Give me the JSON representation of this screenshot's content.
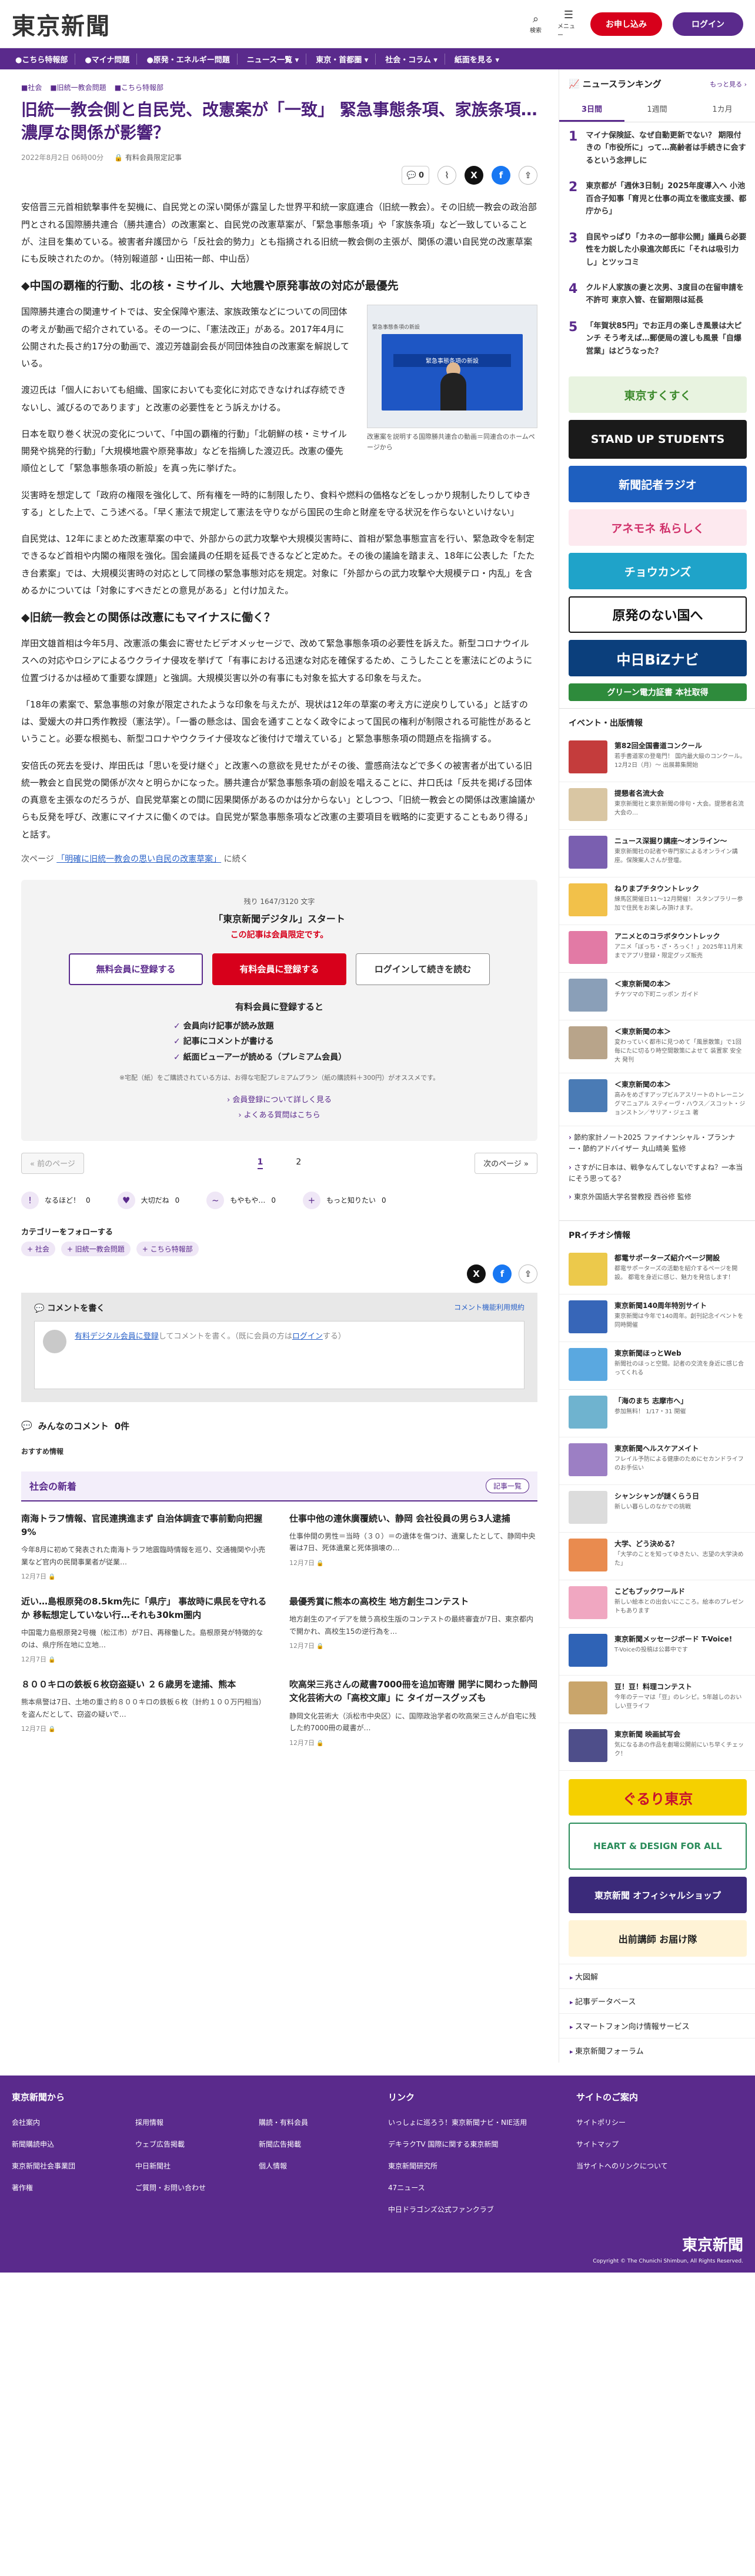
{
  "header": {
    "logo": "東京新聞",
    "search": "検索",
    "menu": "メニュー",
    "subscribe": "お申し込み",
    "login": "ログイン"
  },
  "nav": [
    "●こちら特報部",
    "●マイナ問題",
    "●原発・エネルギー問題",
    "ニュース一覧 ▾",
    "東京・首都圏 ▾",
    "社会・コラム ▾",
    "紙面を見る ▾"
  ],
  "article": {
    "crumbs": [
      "■社会",
      "■旧統一教会問題",
      "■こちら特報部"
    ],
    "title": "旧統一教会側と自民党、改憲案が「一致」 緊急事態条項、家族条項…濃厚な関係が影響？",
    "date": "2022年8月2日 06時00分",
    "paid": "有料会員限定記事",
    "comment_count": "0",
    "p1": "安倍晋三元首相銃撃事件を契機に、自民党との深い関係が露呈した世界平和統一家庭連合（旧統一教会）。その旧統一教会の政治部門とされる国際勝共連合（勝共連合）の改憲案と、自民党の改憲草案が、「緊急事態条項」や「家族条項」など一致していることが、注目を集めている。被害者弁護団から「反社会的勢力」とも指摘される旧統一教会側の主張が、関係の濃い自民党の改憲草案にも反映されたのか。（特別報道部・山田祐一郎、中山岳）",
    "h1": "◆中国の覇権的行動、北の核・ミサイル、大地震や原発事故の対応が最優先",
    "p2": "国際勝共連合の関連サイトでは、安全保障や憲法、家族政策などについての同団体の考えが動画で紹介されている。その一つに、「憲法改正」がある。2017年4月に公開された長さ約17分の動画で、渡辺芳雄副会長が同団体独自の改憲案を解説している。",
    "p3": "渡辺氏は「個人においても組織、国家においても変化に対応できなければ存続できないし、滅びるのであります」と改憲の必要性をとう訴えかける。",
    "p4": "日本を取り巻く状況の変化について、「中国の覇権的行動」「北朝鮮の核・ミサイル開発や挑発的行動」「大規模地震や原発事故」などを指摘した渡辺氏。改憲の優先順位として「緊急事態条項の新設」を真っ先に挙げた。",
    "fig_tag": "緊急事態条項の新設",
    "fig_screen": "緊急事態条項の新設",
    "fig_caption": "改憲案を説明する国際勝共連合の動画＝同連合のホームページから",
    "p5": "災害時を想定して「政府の権限を強化して、所有権を一時的に制限したり、食料や燃料の価格などをしっかり規制したりしてゆきする」とした上で、こう述べる。「早く憲法で規定して憲法を守りながら国民の生命と財産を守る状況を作らないといけない」",
    "p6": "自民党は、12年にまとめた改憲草案の中で、外部からの武力攻撃や大規模災害時に、首相が緊急事態宣言を行い、緊急政令を制定できるなど首相や内閣の権限を強化。国会議員の任期を延長できるなどと定めた。その後の議論を踏まえ、18年に公表した「たたき台素案」では、大規模災害時の対応として同様の緊急事態対応を規定。対象に「外部からの武力攻撃や大規模テロ・内乱」を含めるかについては「対象にすべきだとの意見がある」と付け加えた。",
    "h2": "◆旧統一教会との関係は改憲にもマイナスに働く？",
    "p7": "岸田文雄首相は今年5月、改憲派の集会に寄せたビデオメッセージで、改めて緊急事態条項の必要性を訴えた。新型コロナウイルスへの対応やロシアによるウクライナ侵攻を挙げて「有事における迅速な対応を確保するため、こうしたことを憲法にどのように位置づけるかは極めて重要な課題」と強調。大規模災害以外の有事にも対象を拡大する印象を与えた。",
    "p8": "「18年の素案で、緊急事態の対象が限定されたような印象を与えたが、現状は12年の草案の考え方に逆戻りしている」と話すのは、愛媛大の井口秀作教授（憲法学）。「一番の懸念は、国会を通すことなく政令によって国民の権利が制限される可能性があるということ。必要な根拠も、新型コロナやウクライナ侵攻など後付けで増えている」と緊急事態条項の問題点を指摘する。",
    "p9": "安倍氏の死去を受け、岸田氏は「思いを受け継ぐ」と改憲への意欲を見せたがその後、霊感商法などで多くの被害者が出ている旧統一教会と自民党の関係が次々と明らかになった。勝共連合が緊急事態条項の創設を唱えることに、井口氏は「反共を掲げる団体の真意を主張なのだろうが、自民党草案との間に因果関係があるのかは分からない」としつつ、「旧統一教会との関係は改憲論議からも反発を呼び、改憲にマイナスに働くのでは。自民党が緊急事態条項など改憲の主要項目を戦略的に変更することもあり得る」と話す。",
    "next_prefix": "次ページ",
    "next_link": "「明確に旧統一教会の思い自民の改憲草案」",
    "next_suffix": "に続く"
  },
  "paywall": {
    "count": "残り 1647/3120 文字",
    "title": "「東京新聞デジタル」スタート",
    "sub": "この記事は会員限定です。",
    "free_btn": "無料会員に登録する",
    "paid_btn": "有料会員に登録する",
    "login_btn": "ログインして続きを読む",
    "benefit_h": "有料会員に登録すると",
    "benefits": [
      "会員向け記事が読み放題",
      "記事にコメントが書ける",
      "紙面ビューアーが読める（プレミアム会員）"
    ],
    "note": "※宅配（紙）をご購読されている方は、お得な宅配プレミアムプラン（紙の購読料＋300円）がオススメです。",
    "link1": "会員登録について詳しく見る",
    "link2": "よくある質問はこちら"
  },
  "pager": {
    "prev": "« 前のページ",
    "pages": [
      "1",
      "2"
    ],
    "next": "次のページ »"
  },
  "reactions": [
    {
      "icon": "!",
      "label": "なるほど！",
      "count": "0"
    },
    {
      "icon": "♥",
      "label": "大切だね",
      "count": "0"
    },
    {
      "icon": "~",
      "label": "もやもや…",
      "count": "0"
    },
    {
      "icon": "+",
      "label": "もっと知りたい",
      "count": "0"
    }
  ],
  "follow": {
    "heading": "カテゴリーをフォローする",
    "tags": [
      "社会",
      "旧統一教会問題",
      "こちら特報部"
    ]
  },
  "comments": {
    "heading": "コメントを書く",
    "rule": "コメント機能利用規約",
    "prompt_link": "有料デジタル会員に登録",
    "prompt_mid": "してコメントを書く。（既に会員の方は",
    "prompt_login": "ログイン",
    "prompt_end": "する）",
    "count_label": "みんなのコメント",
    "count": "0件"
  },
  "reco": "おすすめ情報",
  "latest": {
    "heading": "社会の新着",
    "more": "記事一覧",
    "items": [
      {
        "title": "南海トラフ情報、官民連携進まず 自治体調査で事前動向把握9%",
        "excerpt": "今年8月に初めて発表された南海トラフ地震臨時情報を巡り、交通機関や小売業など官内の民間事業者が従業…",
        "date": "12月7日"
      },
      {
        "title": "仕事中他の連休廣覆続い、静岡 会社役員の男ら3人逮捕",
        "excerpt": "仕事仲間の男性＝当時（３０）＝の遺体を傷つけ、遺棄したとして、静岡中央署は7日、死体遺棄と死体損壊の…",
        "date": "12月7日"
      },
      {
        "title": "近い…島根原発の8.5km先に「県庁」 事故時に県民を守れるか 移転想定していない行…それも30km圏内",
        "excerpt": "中国電力島根原発2号機（松江市）が7日、再稼働した。島根原発が特徴的なのは、県庁所在地に立地…",
        "date": "12月7日"
      },
      {
        "title": "最優秀賞に熊本の高校生 地方創生コンテスト",
        "excerpt": "地方創生のアイデアを競う高校生版のコンテストの最終審査が7日、東京都内で開かれ、高校生15の逆行為を…",
        "date": "12月7日"
      },
      {
        "title": "８００キロの鉄板６枚窃盗疑い ２６歳男を逮捕、熊本",
        "excerpt": "熊本県警は7日、土地の重さ約８００キロの鉄板６枚（計約１００万円相当）を盗んだとして、窃盗の疑いで…",
        "date": "12月7日"
      },
      {
        "title": "吹高栄三兆さんの蔵書7000冊を追加寄贈 開学に関わった静岡文化芸術大の「高校文庫」に タイガースグッズも",
        "excerpt": "静岡文化芸術大（浜松市中央区）に、国際政治学者の吹高栄三さんが自宅に残した約7000冊の蔵書が…",
        "date": "12月7日"
      }
    ]
  },
  "sidebar": {
    "ranking_title": "ニュースランキング",
    "ranking_more": "もっと見る ›",
    "tabs": [
      "3日間",
      "1週間",
      "1カ月"
    ],
    "ranking": [
      {
        "n": "1",
        "text": "マイナ保険証、なぜ自動更新でない？ 期限付きの「市役所に」って…高齢者は手続きに会するという念押しに"
      },
      {
        "n": "2",
        "text": "東京都が「週休3日制」2025年度導入へ 小池百合子知事「育児と仕事の両立を徹底支援、都庁から」"
      },
      {
        "n": "3",
        "text": "自民やっぱり「カネの一部非公開」議員ら必要性を力説した小泉進次郎氏に「それは吸引力し」とツッコミ"
      },
      {
        "n": "4",
        "text": "クルド人家族の妻と次男、3度目の在留申請を不許可 東京入管、在留期限は延長"
      },
      {
        "n": "5",
        "text": "「年賀状85円」でお正月の楽しき風景は大ピンチ そう考えば…郵便局の渡しも風景「自爆営業」はどうなった？"
      }
    ],
    "banners": [
      "東京すくすく",
      "STAND UP STUDENTS",
      "新聞記者ラジオ",
      "アネモネ 私らしく",
      "チョウカンズ",
      "原発のない国へ",
      "中日BiZナビ",
      "グリーン電力証書 本社取得"
    ],
    "events_title": "イベント・出版情報",
    "events": [
      {
        "title": "第82回全国書道コンクール",
        "desc": "若手書道家の登竜門！ 国内最大級のコンクール。12月2日（月）～ 出展募集開始"
      },
      {
        "title": "提懇者名流大会",
        "desc": "東京新聞社と東京新聞の俳句・大会。提懇者名流大会の…"
      },
      {
        "title": "ニュース深掘り講座～オンライン～",
        "desc": "東京新聞社の記者や専門家によるオンライン講座。保険案人さんが登壇。"
      },
      {
        "title": "ねりまプチタウントレック",
        "desc": "練馬区開催日11～12月開催！ スタンプラリー参加で住民をお楽しみ頂けます。"
      },
      {
        "title": "アニメとのコラボタウントレック",
        "desc": "アニメ「ぼっち・ざ・ろっく！」2025年11月末までアプリ登録・限定グッズ販売"
      },
      {
        "title": "＜東京新聞の本＞",
        "desc": "チケツマの下町ニッポン ガイド"
      },
      {
        "title": "＜東京新聞の本＞",
        "desc": "変わっていく都市に見つめて「風景散策」で1回毎にたに切るり時空間散策によせて 装置家 安全大 発刊"
      },
      {
        "title": "＜東京新聞の本＞",
        "desc": "高みをめざすアップビルアスリートのトレーニングマニュアル スティーヴ・ハウス／スコット・ジョンストン／サリア・ジェユ 著"
      }
    ],
    "links": [
      "節約家計ノート2025 ファイナンシャル・プランナー・節約アドバイザー 丸山晴美 監修",
      "さすがに日本は、戦争なんてしないですよね？一本当にそう思ってる？",
      "東京外国語大学名誉教授 西谷修 監修"
    ],
    "pr_title": "PRイチオシ情報",
    "pr": [
      {
        "title": "都電サポーターズ紹介ページ開設",
        "desc": "都電サポーターズの活動を紹介するページを開設。 都電を身近に感じ、魅力を発信します！"
      },
      {
        "title": "東京新聞140周年特別サイト",
        "desc": "東京新聞は今年で140周年。創刊記念イベントを同時開催"
      },
      {
        "title": "東京新聞ほっとWeb",
        "desc": "新聞社のほっと空間。記者の交流を身近に感じ合ってくれる"
      },
      {
        "title": "「海のまち 志摩市へ」",
        "desc": "参加無料！ 1/17・31 開催"
      },
      {
        "title": "東京新聞ヘルスケアメイト",
        "desc": "フレイル予防による健康のためにセカンドライフのお手伝い"
      },
      {
        "title": "シャンシャンが謎くらう日",
        "desc": "新しい暮らしのなかでの挑戦"
      },
      {
        "title": "大学、どう決める？",
        "desc": "「大学のことを知ってゆきたい、志望の大学決めた」"
      },
      {
        "title": "こどもブックワールド",
        "desc": "新しい絵本との出会いにこころ。絵本のプレゼントもあります"
      },
      {
        "title": "東京新聞メッセージボード T-Voice!",
        "desc": "T-Voiceの投稿は公募中です"
      },
      {
        "title": "豆！豆！料理コンテスト",
        "desc": "今年のテーマは「豆」のレシピ。5年越しのおいしい豆ライフ"
      },
      {
        "title": "東京新聞 映画試写会",
        "desc": "気になるあの作品を劇場公開前にいち早くチェック！"
      }
    ],
    "banners2": [
      "ぐるり東京",
      "HEART & DESIGN FOR ALL",
      "東京新聞 オフィシャルショップ",
      "出前講師 お届け隊"
    ],
    "menu": [
      "大図解",
      "記事データベース",
      "スマートフォン向け情報サービス",
      "東京新聞フォーラム"
    ]
  },
  "footer": {
    "col1_title": "東京新聞から",
    "col1": [
      "会社案内",
      "採用情報",
      "購読・有料会員",
      "新聞購読申込",
      "ウェブ広告掲載",
      "新聞広告掲載",
      "東京新聞社会事業団",
      "中日新聞社",
      "個人情報",
      "著作権",
      "ご質問・お問い合わせ"
    ],
    "col2_title": "リンク",
    "col2": [
      "いっしょに巡ろう！東京新聞ナビ・NIE活用",
      "デキラクTV 国際に関する東京新聞",
      "東京新聞研究所",
      "47ニュース",
      "中日ドラゴンズ公式ファンクラブ"
    ],
    "col3_title": "サイトのご案内",
    "col3": [
      "サイトポリシー",
      "サイトマップ",
      "当サイトへのリンクについて"
    ],
    "logo": "東京新聞",
    "copyright": "Copyright © The Chunichi Shimbun, All Rights Reserved."
  },
  "colors": {
    "brand": "#5a2a8c",
    "accent_red": "#d7001b"
  }
}
